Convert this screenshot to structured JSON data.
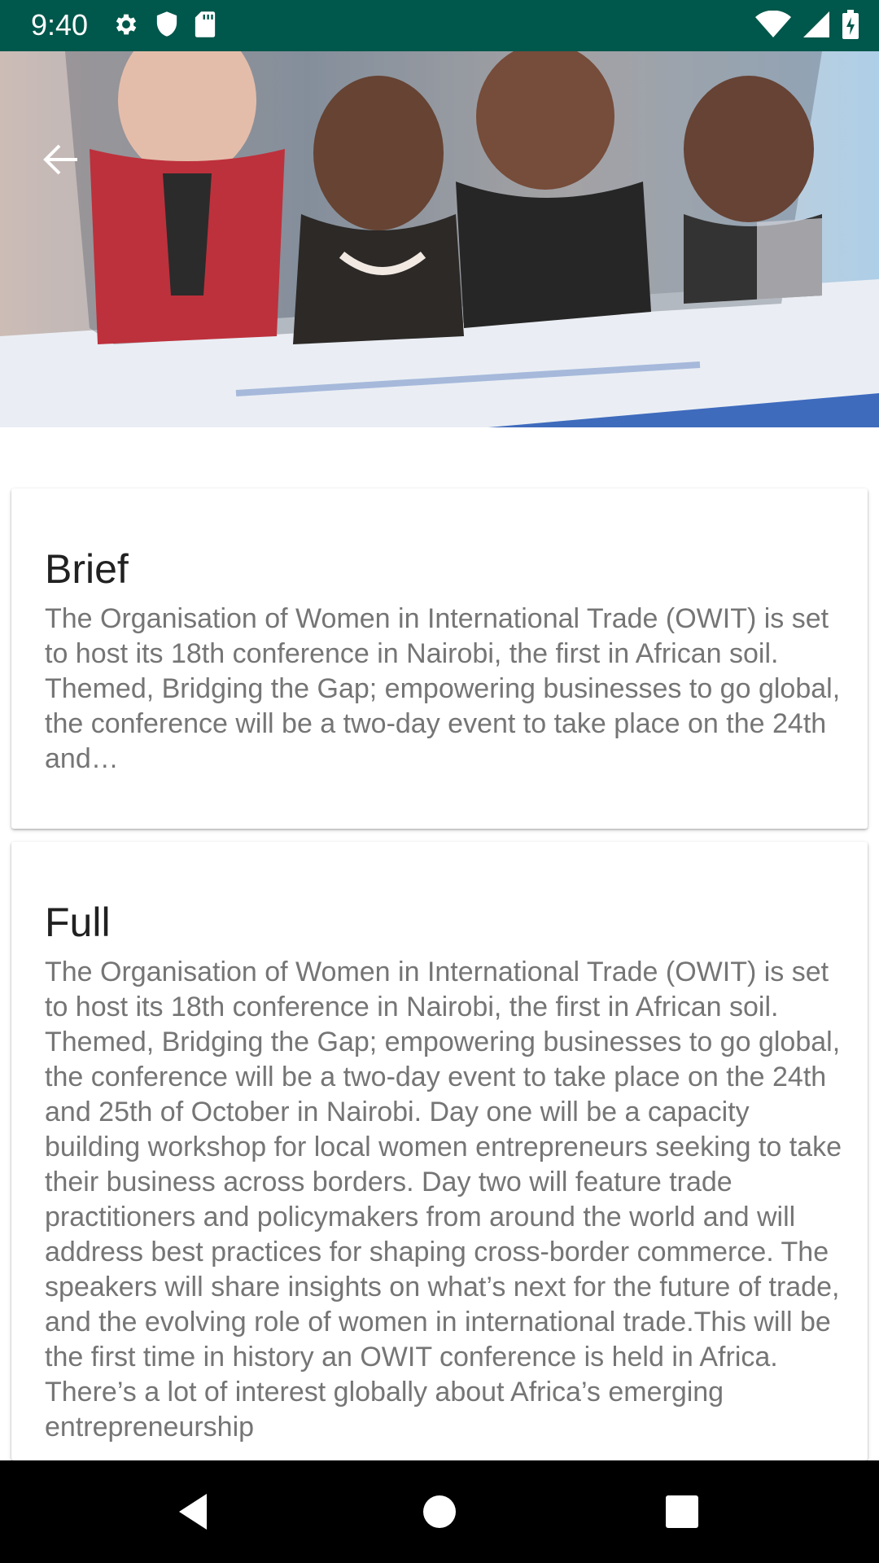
{
  "status_bar": {
    "time": "9:40",
    "left_icons": [
      "gear-icon",
      "shield-icon",
      "sd-card-icon"
    ],
    "right_icons": [
      "wifi-icon",
      "signal-icon",
      "battery-icon"
    ],
    "background_color": "#00574b"
  },
  "hero": {
    "image_description_icon": "event-photo",
    "back_icon": "arrow-back-icon"
  },
  "cards": [
    {
      "title": "Brief",
      "body": "The Organisation of Women in International Trade (OWIT) is set to host its 18th conference in Nairobi, the first in African soil. Themed, Bridging the Gap; empowering businesses to go global, the conference will be a two-day event to take place on the 24th and…"
    },
    {
      "title": "Full",
      "body": "The Organisation of Women in International Trade (OWIT) is set to host its 18th conference in Nairobi, the first in African soil. Themed, Bridging the Gap; empowering businesses to go global, the conference will be a two-day event to take place on the 24th and 25th of October in Nairobi. Day one will be a capacity building workshop for local women entrepreneurs seeking to take their business across borders. Day two will feature trade practitioners and policymakers from around the world and will address best practices for shaping cross-border commerce. The speakers will share insights on what’s next for the future of trade, and the evolving role of women in international trade.This will be the first time in history an OWIT conference is held in Africa. There’s a lot of interest globally about Africa’s emerging entrepreneurship"
    }
  ],
  "nav_bar": {
    "buttons": [
      "back-triangle-icon",
      "home-circle-icon",
      "recents-square-icon"
    ]
  }
}
